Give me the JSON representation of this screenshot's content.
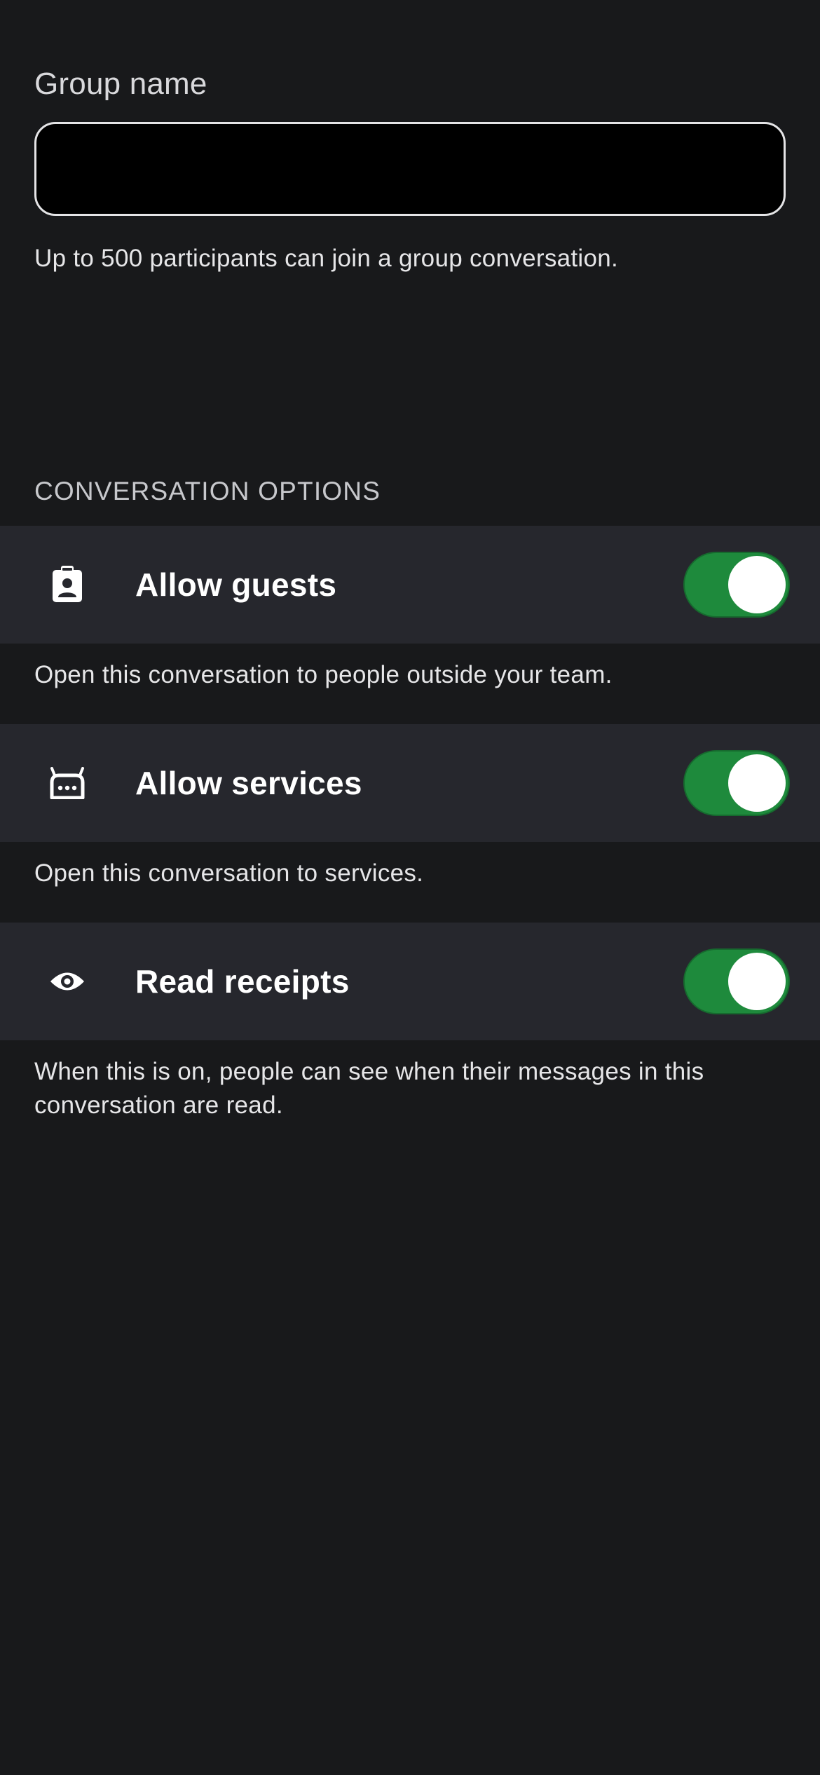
{
  "group_name": {
    "label": "Group name",
    "value": "",
    "placeholder": "",
    "hint": "Up to 500 participants can join a group conversation."
  },
  "options": {
    "section_title": "CONVERSATION OPTIONS",
    "items": [
      {
        "label": "Allow guests",
        "icon": "guest-badge-icon",
        "enabled": true,
        "description": "Open this conversation to people outside your team."
      },
      {
        "label": "Allow services",
        "icon": "service-bot-icon",
        "enabled": true,
        "description": "Open this conversation to services."
      },
      {
        "label": "Read receipts",
        "icon": "eye-icon",
        "enabled": true,
        "description_line1": "When this is on, people can see when their messages in this",
        "description_line2": "conversation are read."
      }
    ]
  },
  "colors": {
    "background": "#18191b",
    "row_background": "#26272d",
    "toggle_on": "#1e8a3c"
  }
}
